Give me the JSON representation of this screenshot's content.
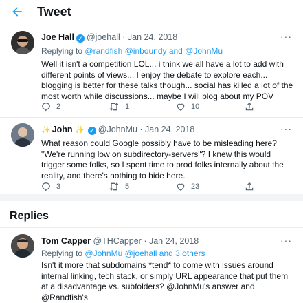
{
  "header": {
    "title": "Tweet",
    "back_icon": "arrow-left-icon"
  },
  "tweets": [
    {
      "name": "Joe Hall",
      "handle": "@joehall",
      "date": "· Jan 24, 2018",
      "replying_prefix": "Replying to",
      "replying_to": "@randfish @inboundy and @JohnMu",
      "body": "Well it isn't a competition LOL... i think we all have a lot to add with different points of views... I enjoy the debate to explore each... blogging is better for these talks though... social has killed a lot of the most worth while discussions... maybe I will blog about my POV",
      "replies": "2",
      "retweets": "1",
      "likes": "10"
    },
    {
      "name_emoji": "✨",
      "name": "John",
      "name_suffix_emoji": "✨",
      "handle": "@JohnMu",
      "date": "· Jan 24, 2018",
      "body": "What reason could Google possibly have to be misleading here? \"We're running low on subdirectory-servers\"? I knew this would trigger some folks, so I spent time to prod folks internally about the reality, and there's nothing to hide here.",
      "replies": "3",
      "retweets": "5",
      "likes": "23"
    }
  ],
  "replies_section": {
    "title": "Replies",
    "items": [
      {
        "name": "Tom Capper",
        "handle": "@THCapper",
        "date": "· Jan 24, 2018",
        "replying_prefix": "Replying to",
        "replying_to": "@JohnMu @joehall and 3 others",
        "body": "Isn't it more that subdomains *tend* to come with issues around internal linking, tech stack, or simply URL appearance that put them at a disadvantage vs. subfolders? @JohnMu's answer and @Randfish's"
      }
    ]
  },
  "colors": {
    "accent": "#1d9bf0",
    "muted": "#536471",
    "text": "#0f1419",
    "divider": "#e6ecf0"
  }
}
